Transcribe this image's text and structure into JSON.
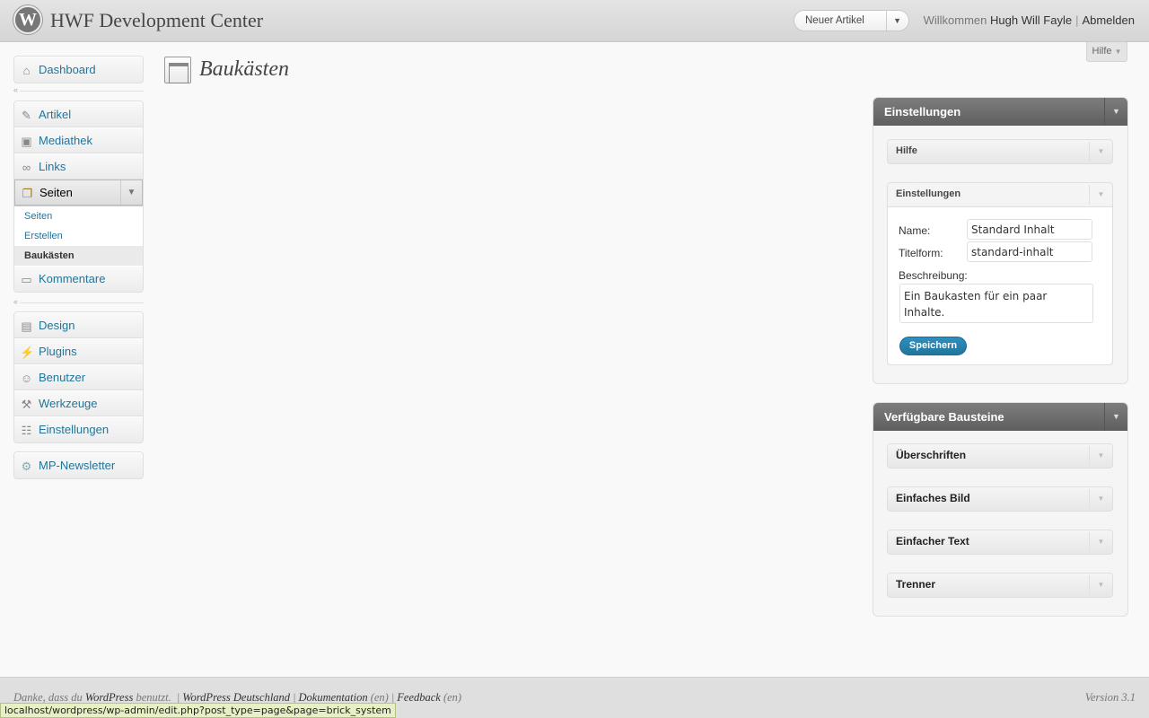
{
  "header": {
    "site_title": "HWF Development Center",
    "new_post_label": "Neuer Artikel",
    "welcome": "Willkommen",
    "user_name": "Hugh Will Fayle",
    "logout": "Abmelden",
    "help_tab": "Hilfe"
  },
  "menu": {
    "dashboard": "Dashboard",
    "group1": [
      "Artikel",
      "Mediathek",
      "Links"
    ],
    "current": "Seiten",
    "submenu": [
      "Seiten",
      "Erstellen",
      "Baukästen"
    ],
    "comments": "Kommentare",
    "group2": [
      "Design",
      "Plugins",
      "Benutzer",
      "Werkzeuge",
      "Einstellungen"
    ],
    "newsletter": "MP-Newsletter"
  },
  "page": {
    "title": "Baukästen"
  },
  "settings_panel": {
    "title": "Einstellungen",
    "help_box": "Hilfe",
    "settings_box": "Einstellungen",
    "name_label": "Name:",
    "name_value": "Standard Inhalt",
    "slug_label": "Titelform:",
    "slug_value": "standard-inhalt",
    "desc_label": "Beschreibung:",
    "desc_value": "Ein Baukasten für ein paar Inhalte.",
    "save_label": "Speichern"
  },
  "bricks_panel": {
    "title": "Verfügbare Bausteine",
    "items": [
      "Überschriften",
      "Einfaches Bild",
      "Einfacher Text",
      "Trenner"
    ]
  },
  "footer": {
    "thanks_pre": "Danke, dass du",
    "wordpress": "WordPress",
    "thanks_post": "benutzt.",
    "link_de": "WordPress Deutschland",
    "docs": "Dokumentation",
    "docs_en": "(en)",
    "feedback": "Feedback",
    "feedback_en": "(en)",
    "version": "Version 3.1"
  },
  "status_bar": "localhost/wordpress/wp-admin/edit.php?post_type=page&page=brick_system"
}
